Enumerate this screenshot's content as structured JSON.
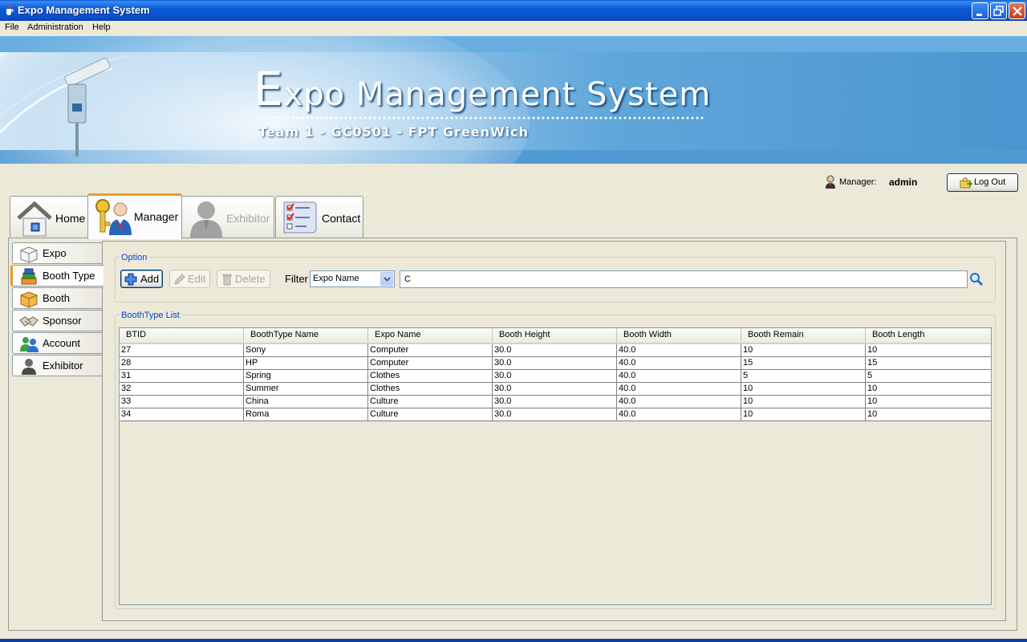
{
  "window": {
    "title": "Expo Management System",
    "icon": "java-cup-icon"
  },
  "menu": [
    "File",
    "Administration",
    "Help"
  ],
  "banner": {
    "title_cap": "E",
    "title_rest": "xpo Management System",
    "subtitle": "Team 1 - GC0501 - FPT GreenWich"
  },
  "user": {
    "label": "Manager:",
    "name": "admin",
    "logout_label": "Log Out"
  },
  "main_tabs": [
    {
      "label": "Home",
      "icon": "home-icon",
      "state": "normal"
    },
    {
      "label": "Manager",
      "icon": "manager-key-icon",
      "state": "active"
    },
    {
      "label": "Exhibitor",
      "icon": "exhibitor-person-icon",
      "state": "disabled"
    },
    {
      "label": "Contact",
      "icon": "contact-checklist-icon",
      "state": "normal"
    }
  ],
  "side_tabs": [
    {
      "label": "Expo",
      "icon": "box-outline-icon"
    },
    {
      "label": "Booth Type",
      "icon": "stacked-blocks-icon",
      "active": true
    },
    {
      "label": "Booth",
      "icon": "box-icon"
    },
    {
      "label": "Sponsor",
      "icon": "handshake-icon"
    },
    {
      "label": "Account",
      "icon": "users-icon"
    },
    {
      "label": "Exhibitor",
      "icon": "person-icon"
    }
  ],
  "option_group": {
    "title": "Option",
    "add_label": "Add",
    "edit_label": "Edit",
    "delete_label": "Delete",
    "filter_label": "Filter",
    "filter_selected": "Expo Name",
    "search_value": "C"
  },
  "list_group": {
    "title": "BoothType List",
    "columns": [
      "BTID",
      "BoothType Name",
      "Expo Name",
      "Booth Height",
      "Booth Width",
      "Booth Remain",
      "Booth Length"
    ],
    "rows": [
      [
        "27",
        "Sony",
        "Computer",
        "30.0",
        "40.0",
        "10",
        "10"
      ],
      [
        "28",
        "HP",
        "Computer",
        "30.0",
        "40.0",
        "15",
        "15"
      ],
      [
        "31",
        "Spring",
        "Clothes",
        "30.0",
        "40.0",
        "5",
        "5"
      ],
      [
        "32",
        "Summer",
        "Clothes",
        "30.0",
        "40.0",
        "10",
        "10"
      ],
      [
        "33",
        "China",
        "Culture",
        "30.0",
        "40.0",
        "10",
        "10"
      ],
      [
        "34",
        "Roma",
        "Culture",
        "30.0",
        "40.0",
        "10",
        "10"
      ]
    ]
  },
  "colors": {
    "titlebar": "#0a5fd8",
    "active_tab_accent": "#e69c2c",
    "group_title": "#0046d5",
    "panel_bg": "#ece9d8"
  }
}
